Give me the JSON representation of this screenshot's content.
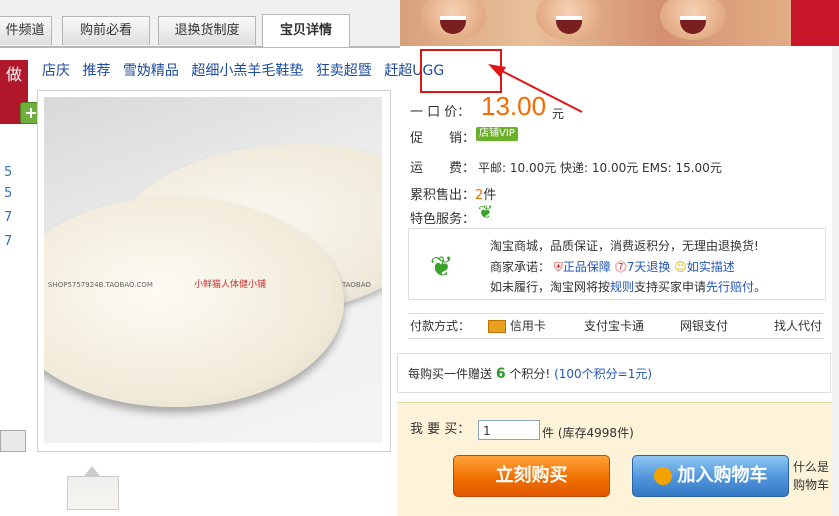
{
  "tabs": [
    {
      "label": "件频道"
    },
    {
      "label": "购前必看"
    },
    {
      "label": "退换货制度"
    },
    {
      "label": "宝贝详情"
    }
  ],
  "left": {
    "badge": "做",
    "nums": [
      "5",
      "5",
      "7",
      "7"
    ]
  },
  "links": [
    "店庆",
    "推荐",
    "雪妫精品",
    "超细小羔羊毛鞋垫",
    "狂卖超暨",
    "赶超UGG"
  ],
  "image": {
    "watermark_left": "SHOP5757924B.TAOBAO.COM",
    "watermark_mid": "小鲜猫人体健小铺",
    "watermark_right": "TAOBAO"
  },
  "product": {
    "price_label": "一 口 价：",
    "price": "13.00",
    "currency": "元",
    "promo_label": "促　　销：",
    "promo_badge": "店铺VIP",
    "shipping_label": "运　　费：",
    "shipping_text": "平邮: 10.00元 快递: 10.00元 EMS: 15.00元",
    "sold_label": "累积售出：",
    "sold_count": "2",
    "sold_unit": "件",
    "features_label": "特色服务："
  },
  "service": {
    "line1": "淘宝商城，品质保证，消费返积分，无理由退换货!",
    "line2_label": "商家承诺：",
    "promise1": "正品保障",
    "promise2": "7天退换",
    "promise3": "如实描述",
    "line3_a": "如未履行，淘宝网将按",
    "line3_rules": "规则",
    "line3_b": "支持买家申请",
    "line3_claim": "先行赔付",
    "line3_c": "。"
  },
  "payment": {
    "label": "付款方式：",
    "options": [
      "信用卡",
      "支付宝卡通",
      "网银支付",
      "找人代付"
    ]
  },
  "points": {
    "prefix": "每购买一件赠送",
    "count": "6",
    "suffix": "个积分!",
    "note": "(100个积分=1元)"
  },
  "buy": {
    "qty_label": "我 要 买：",
    "qty_value": "1",
    "qty_unit": "件",
    "stock": "(库存4998件)",
    "buy_now": "立刻购买",
    "add_cart": "加入购物车",
    "side1": "什么是",
    "side2": "购物车"
  },
  "colors": {
    "price": "#f56a00",
    "highlight_box": "#e01616",
    "link": "#1d4ba0"
  }
}
